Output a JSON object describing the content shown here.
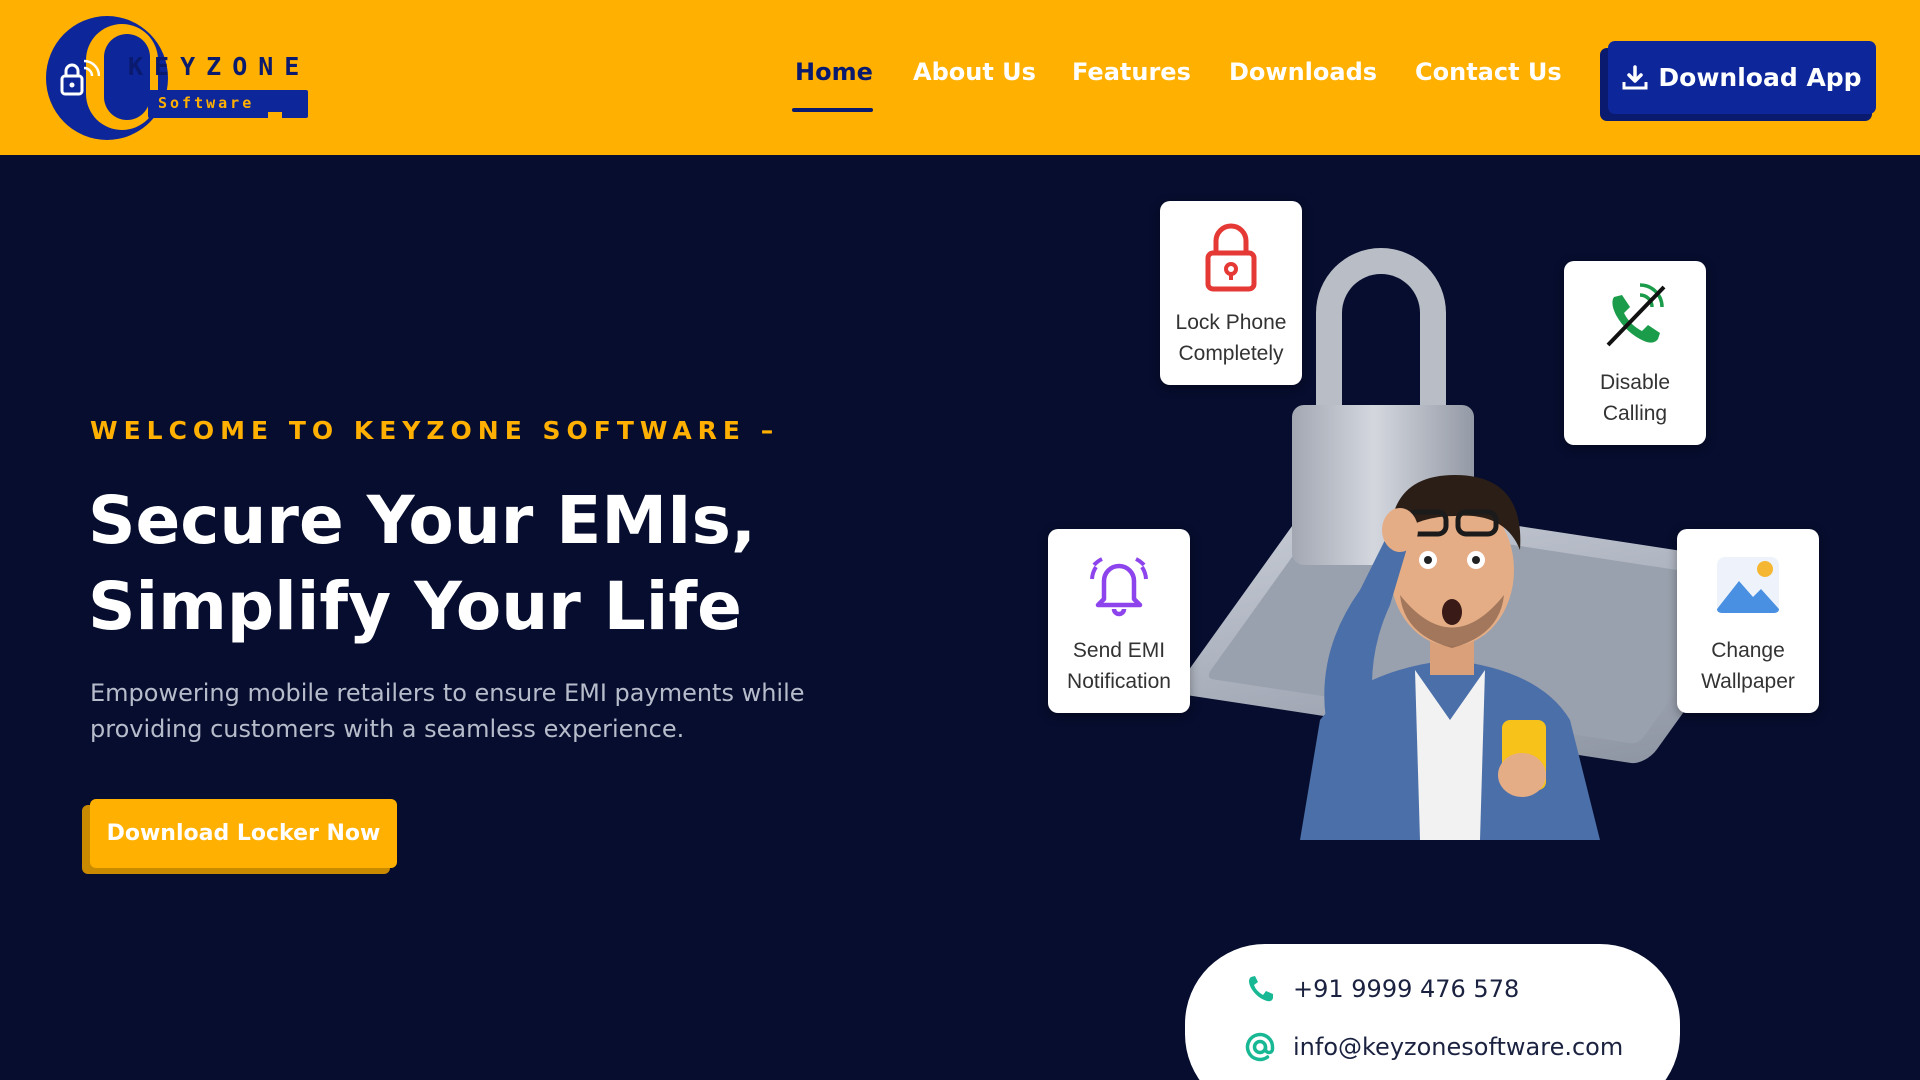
{
  "brand": {
    "name": "KEYZONE",
    "subtitle": "Software",
    "colors": {
      "primary": "#ffb000",
      "navy": "#0d2699",
      "background": "#060d2e"
    }
  },
  "nav": {
    "items": [
      {
        "label": "Home",
        "active": true
      },
      {
        "label": "About Us",
        "active": false
      },
      {
        "label": "Features",
        "active": false
      },
      {
        "label": "Downloads",
        "active": false
      },
      {
        "label": "Contact Us",
        "active": false
      }
    ],
    "download_button": {
      "label": "Download App",
      "icon": "download-icon"
    }
  },
  "hero": {
    "eyebrow": "WELCOME TO KEYZONE SOFTWARE –",
    "headline_line1": "Secure Your EMIs,",
    "headline_line2": "Simplify Your Life",
    "description": "Empowering mobile retailers to ensure EMI payments while providing customers with a seamless experience.",
    "cta_label": "Download Locker Now"
  },
  "features": [
    {
      "line1": "Lock Phone",
      "line2": "Completely",
      "icon": "padlock-icon"
    },
    {
      "line1": "Disable",
      "line2": "Calling",
      "icon": "phone-disabled-icon"
    },
    {
      "line1": "Send EMI",
      "line2": "Notification",
      "icon": "bell-icon"
    },
    {
      "line1": "Change",
      "line2": "Wallpaper",
      "icon": "image-icon"
    }
  ],
  "contact": {
    "phone": "+91 9999 476 578",
    "email": "info@keyzonesoftware.com"
  }
}
